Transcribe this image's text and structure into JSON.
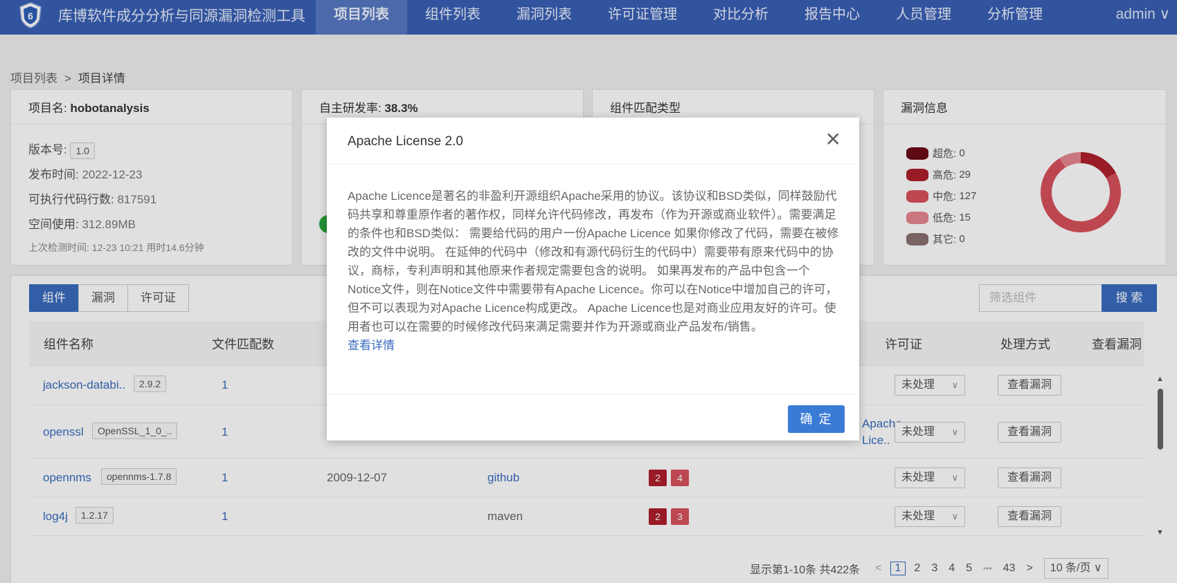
{
  "nav": {
    "app_title": "库博软件成分分析与同源漏洞检测工具",
    "items": [
      "项目列表",
      "组件列表",
      "漏洞列表",
      "许可证管理",
      "对比分析",
      "报告中心",
      "人员管理",
      "分析管理"
    ],
    "active_index": 0,
    "user": "admin ∨"
  },
  "breadcrumb": {
    "parent": "项目列表",
    "sep": ">",
    "current": "项目详情"
  },
  "project_card": {
    "name_label": "项目名:",
    "name": "hobotanalysis",
    "version_label": "版本号:",
    "version": "1.0",
    "release_label": "发布时间:",
    "release": "2022-12-23",
    "loc_label": "可执行代码行数:",
    "loc": "817591",
    "space_label": "空间使用:",
    "space": "312.89MB",
    "last_scan": "上次检测时间: 12-23 10:21  用时14.6分钟"
  },
  "rd_card": {
    "label": "自主研发率:",
    "value": "38.3%"
  },
  "match_card": {
    "title": "组件匹配类型"
  },
  "vuln_card": {
    "title": "漏洞信息",
    "legend": [
      {
        "label": "超危:",
        "value": "0",
        "color": "#6b0a16"
      },
      {
        "label": "高危:",
        "value": "29",
        "color": "#ad1f2c"
      },
      {
        "label": "中危:",
        "value": "127",
        "color": "#d8515d"
      },
      {
        "label": "低危:",
        "value": "15",
        "color": "#e68790"
      },
      {
        "label": "其它:",
        "value": "0",
        "color": "#8a7070"
      }
    ]
  },
  "tabs": [
    "组件",
    "漏洞",
    "许可证"
  ],
  "filter": {
    "placeholder": "筛选组件",
    "button": "搜 索"
  },
  "table": {
    "headers": {
      "name": "组件名称",
      "files": "文件匹配数",
      "license": "许可证",
      "handling": "处理方式",
      "view": "查看漏洞"
    },
    "rows": [
      {
        "name": "jackson-databi..",
        "version": "2.9.2",
        "files": "1",
        "date": "",
        "source": "",
        "sev": [],
        "license": "",
        "handling": "未处理",
        "view": "查看漏洞"
      },
      {
        "name": "openssl",
        "version": "OpenSSL_1_0_..",
        "files": "1",
        "date": "",
        "source": "",
        "sev": [],
        "license": "Apache Lice..",
        "handling": "未处理",
        "view": "查看漏洞"
      },
      {
        "name": "opennms",
        "version": "opennms-1.7.8",
        "files": "1",
        "date": "2009-12-07",
        "source": "github",
        "sev": [
          {
            "v": "2",
            "c": "#ad1f2c"
          },
          {
            "v": "4",
            "c": "#d8515d"
          }
        ],
        "license": "",
        "handling": "未处理",
        "view": "查看漏洞"
      },
      {
        "name": "log4j",
        "version": "1.2.17",
        "files": "1",
        "date": "",
        "source": "maven",
        "sev": [
          {
            "v": "2",
            "c": "#ad1f2c"
          },
          {
            "v": "3",
            "c": "#d8515d"
          }
        ],
        "license": "",
        "handling": "未处理",
        "view": "查看漏洞"
      }
    ]
  },
  "pager": {
    "summary": "显示第1-10条 共422条",
    "prev": "<",
    "pages": [
      "1",
      "2",
      "3",
      "4",
      "5"
    ],
    "ellipsis": "•••",
    "last": "43",
    "next": ">",
    "size": "10 条/页 ∨"
  },
  "modal": {
    "title": "Apache License 2.0",
    "close": "✕",
    "body": "Apache Licence是著名的非盈利开源组织Apache采用的协议。该协议和BSD类似，同样鼓励代码共享和尊重原作者的著作权，同样允许代码修改，再发布（作为开源或商业软件）。需要满足的条件也和BSD类似： 需要给代码的用户一份Apache Licence 如果你修改了代码，需要在被修改的文件中说明。 在延伸的代码中（修改和有源代码衍生的代码中）需要带有原来代码中的协议，商标，专利声明和其他原来作者规定需要包含的说明。 如果再发布的产品中包含一个Notice文件，则在Notice文件中需要带有Apache Licence。你可以在Notice中增加自己的许可，但不可以表现为对Apache Licence构成更改。 Apache Licence也是对商业应用友好的许可。使用者也可以在需要的时候修改代码来满足需要并作为开源或商业产品发布/销售。",
    "more": "查看详情",
    "ok": "确 定"
  }
}
